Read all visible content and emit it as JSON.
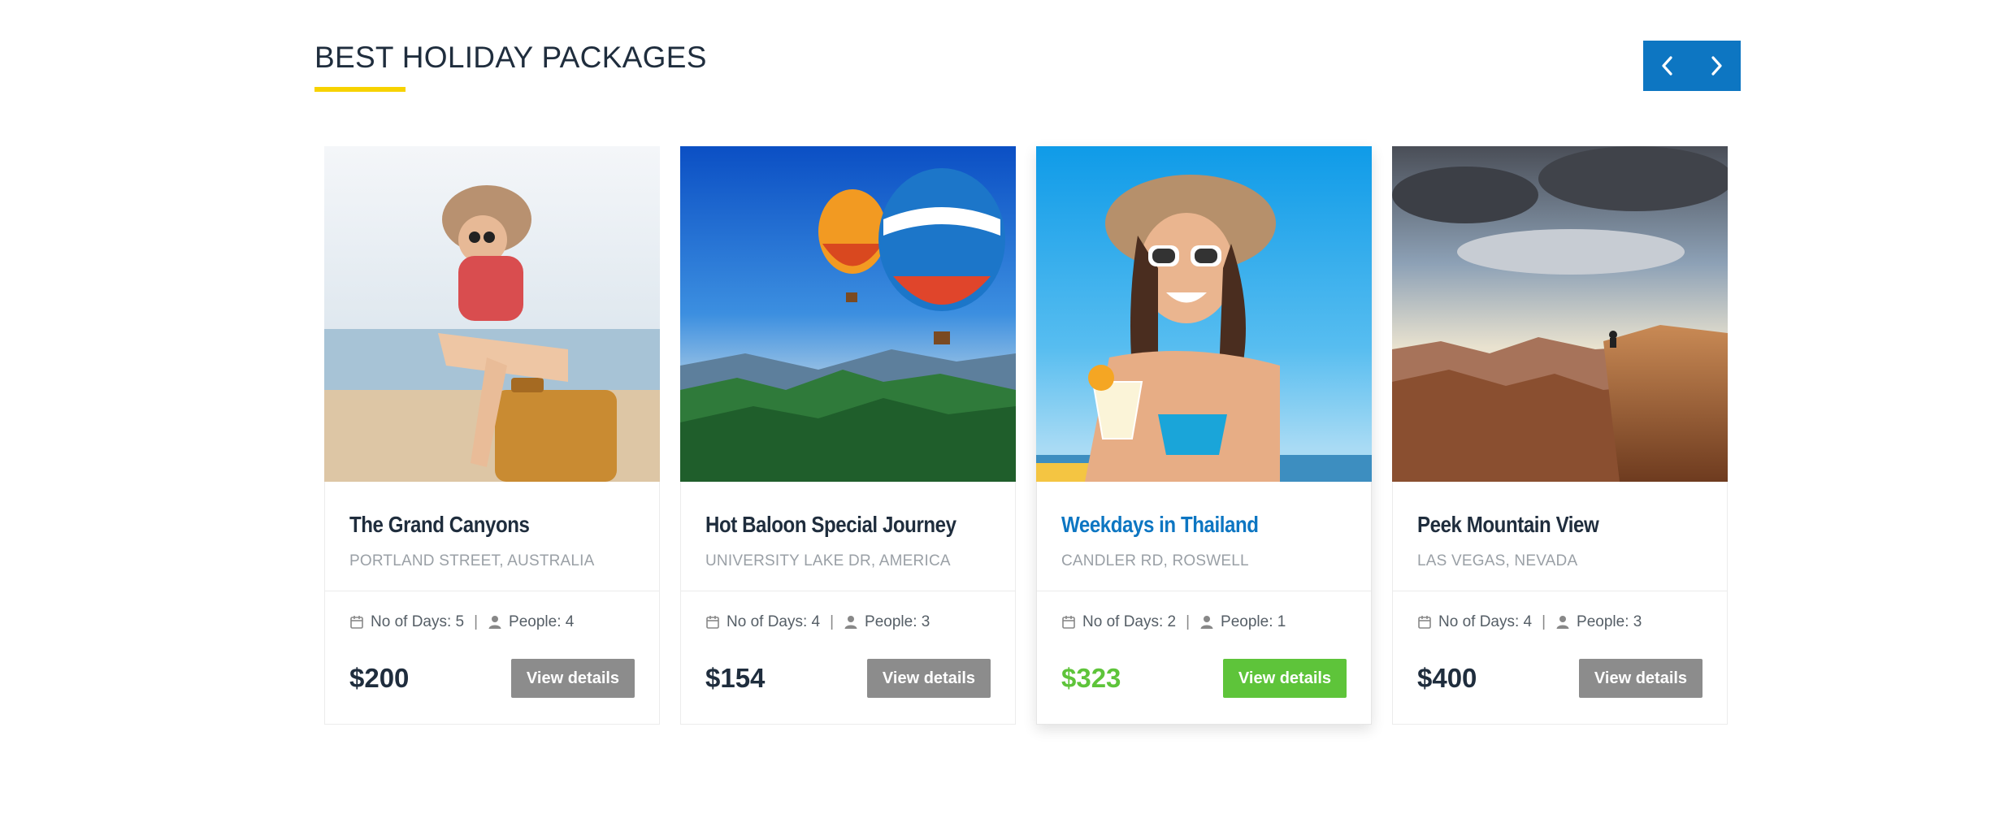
{
  "section": {
    "title": "BEST HOLIDAY PACKAGES",
    "accent_color": "#f7d200",
    "nav_color": "#0d76c2",
    "prev_icon": "chevron-left-icon",
    "next_icon": "chevron-right-icon"
  },
  "packages": [
    {
      "title": "The Grand Canyons",
      "location": "PORTLAND STREET, AUSTRALIA",
      "days_label": "No of Days: 5",
      "people_label": "People: 4",
      "price": "$200",
      "button_label": "View details",
      "image": "woman-on-suitcase-at-beach",
      "active": false
    },
    {
      "title": "Hot Baloon Special Journey",
      "location": "UNIVERSITY LAKE DR, AMERICA",
      "days_label": "No of Days: 4",
      "people_label": "People: 3",
      "price": "$154",
      "button_label": "View details",
      "image": "hot-air-balloons-over-mountains",
      "active": false
    },
    {
      "title": "Weekdays in Thailand",
      "location": "CANDLER RD, ROSWELL",
      "days_label": "No of Days: 2",
      "people_label": "People: 1",
      "price": "$323",
      "button_label": "View details",
      "image": "woman-with-cocktail-on-beach",
      "active": true
    },
    {
      "title": "Peek Mountain View",
      "location": "LAS VEGAS, NEVADA",
      "days_label": "No of Days: 4",
      "people_label": "People: 3",
      "price": "$400",
      "button_label": "View details",
      "image": "canyon-cliff-at-sunset",
      "active": false
    }
  ],
  "colors": {
    "active_title": "#0d76c2",
    "active_price": "#5ec43a",
    "active_button": "#5ec43a",
    "inactive_button": "#8c8c8c"
  }
}
